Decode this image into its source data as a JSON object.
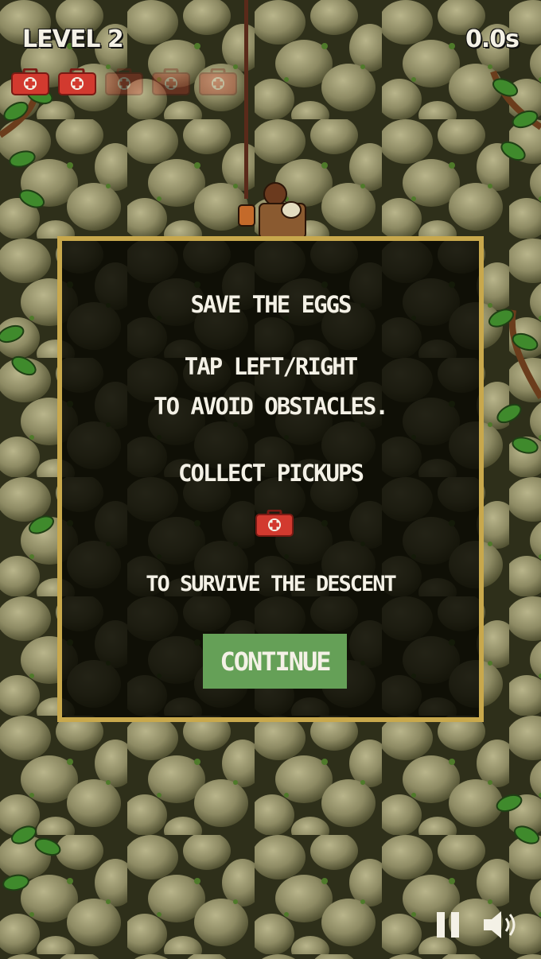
{
  "hud": {
    "level": "LEVEL 2",
    "timer": "0.0s",
    "health": {
      "max": 5,
      "current": 2,
      "icon": "medkit-icon"
    }
  },
  "dialog": {
    "title": "SAVE THE EGGS",
    "instruction_line1": "TAP LEFT/RIGHT",
    "instruction_line2": "TO AVOID OBSTACLES.",
    "collect": "COLLECT PICKUPS",
    "pickup_icon": "medkit-icon",
    "survive": "TO SURVIVE THE DESCENT",
    "continue_label": "CONTINUE"
  },
  "controls": {
    "pause_icon": "pause-icon",
    "sound_icon": "sound-icon"
  },
  "colors": {
    "dialog_border": "#c8a84c",
    "button_green": "#65a057",
    "medkit_red": "#d23a2f",
    "text": "#f4f1e6"
  }
}
